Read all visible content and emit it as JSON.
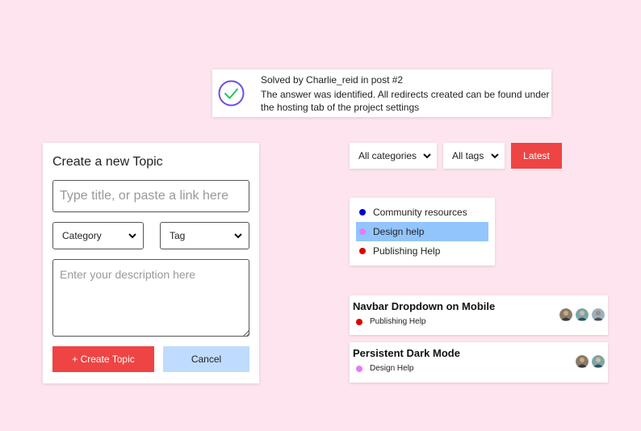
{
  "solved_banner": {
    "title": "Solved by Charlie_reid in post #2",
    "message_line1": "The answer was identified. All redirects created can be found under",
    "message_line2": "the hosting tab of the project settings",
    "icon": "check-circle-icon",
    "icon_color": "#6d4ee6",
    "check_color": "#22c55e"
  },
  "create_topic": {
    "heading": "Create a new Topic",
    "title_placeholder": "Type title, or paste a link here",
    "category_select": "Category",
    "tag_select": "Tag",
    "description_placeholder": "Enter your description here",
    "create_label": "+ Create Topic",
    "cancel_label": "Cancel"
  },
  "filters": {
    "category": "All categories",
    "tags": "All tags",
    "latest_label": "Latest"
  },
  "categories": [
    {
      "label": "Community resources",
      "color": "#0000cc",
      "selected": false
    },
    {
      "label": "Design help",
      "color": "#e879f9",
      "selected": true
    },
    {
      "label": "Publishing Help",
      "color": "#e00000",
      "selected": false
    }
  ],
  "topics": [
    {
      "title": "Navbar Dropdown on Mobile",
      "category": "Publishing Help",
      "category_color": "#e00000",
      "participants": 3
    },
    {
      "title": "Persistent Dark Mode",
      "category": "Design Help",
      "category_color": "#e879f9",
      "participants": 2
    }
  ],
  "colors": {
    "background": "#fde4ee",
    "accent_red": "#ef4444",
    "accent_blue_light": "#bfdbfe",
    "selection_blue": "#93c5fd"
  }
}
